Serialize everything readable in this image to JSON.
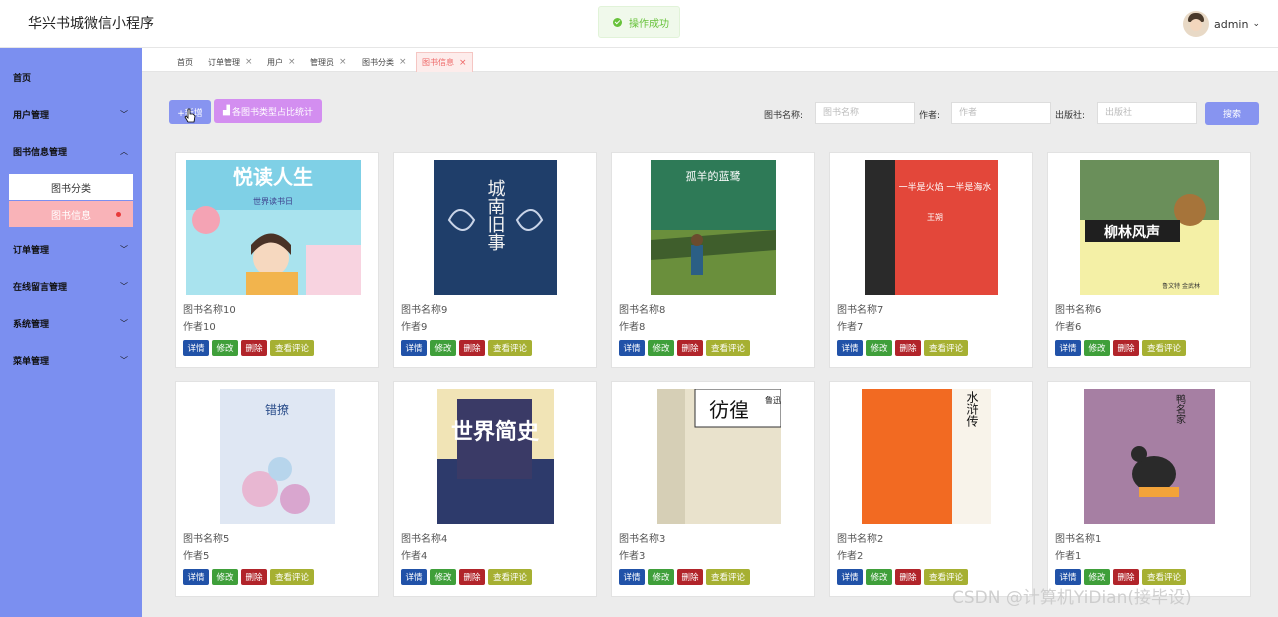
{
  "app": {
    "title": "华兴书城微信小程序",
    "toast": "操作成功",
    "user": "admin"
  },
  "sidebar": {
    "items": [
      {
        "label": "首页",
        "expandable": false
      },
      {
        "label": "用户管理",
        "expandable": true
      },
      {
        "label": "图书信息管理",
        "expandable": true,
        "expanded": true
      },
      {
        "label": "订单管理",
        "expandable": true
      },
      {
        "label": "在线留言管理",
        "expandable": true
      },
      {
        "label": "系统管理",
        "expandable": true
      },
      {
        "label": "菜单管理",
        "expandable": true
      }
    ],
    "subitems": [
      {
        "label": "图书分类"
      },
      {
        "label": "图书信息",
        "active": true
      }
    ]
  },
  "tabs": [
    {
      "label": "首页",
      "closable": false
    },
    {
      "label": "订单管理",
      "closable": true
    },
    {
      "label": "用户",
      "closable": true
    },
    {
      "label": "管理员",
      "closable": true
    },
    {
      "label": "图书分类",
      "closable": true
    },
    {
      "label": "图书信息",
      "closable": true,
      "active": true
    }
  ],
  "toolbar": {
    "add_label": "+新增",
    "stats_label": "各图书类型占比统计",
    "search_button": "搜索",
    "filters": [
      {
        "label": "图书名称:",
        "placeholder": "图书名称"
      },
      {
        "label": "作者:",
        "placeholder": "作者"
      },
      {
        "label": "出版社:",
        "placeholder": "出版社"
      }
    ]
  },
  "actions": {
    "detail": "详情",
    "edit": "修改",
    "delete": "删除",
    "comments": "查看评论"
  },
  "books": [
    {
      "name": "图书名称10",
      "author": "作者10",
      "cover_title": "悦读人生",
      "cover_sub": "世界读书日"
    },
    {
      "name": "图书名称9",
      "author": "作者9",
      "cover_title": "城南旧事"
    },
    {
      "name": "图书名称8",
      "author": "作者8",
      "cover_title": "孤羊的蓝鹭"
    },
    {
      "name": "图书名称7",
      "author": "作者7",
      "cover_title": "一半是火焰 一半是海水",
      "cover_author": "王朔"
    },
    {
      "name": "图书名称6",
      "author": "作者6",
      "cover_title": "柳林风声",
      "cover_author": "鲁文特 金武林"
    },
    {
      "name": "图书名称5",
      "author": "作者5",
      "cover_title": "错撩"
    },
    {
      "name": "图书名称4",
      "author": "作者4",
      "cover_title": "世界简史"
    },
    {
      "name": "图书名称3",
      "author": "作者3",
      "cover_title": "彷徨",
      "cover_author": "鲁迅"
    },
    {
      "name": "图书名称2",
      "author": "作者2",
      "cover_title": "水浒传"
    },
    {
      "name": "图书名称1",
      "author": "作者1",
      "cover_title": "鸭名家"
    }
  ],
  "watermark": "CSDN @计算机YiDian(接毕设)"
}
